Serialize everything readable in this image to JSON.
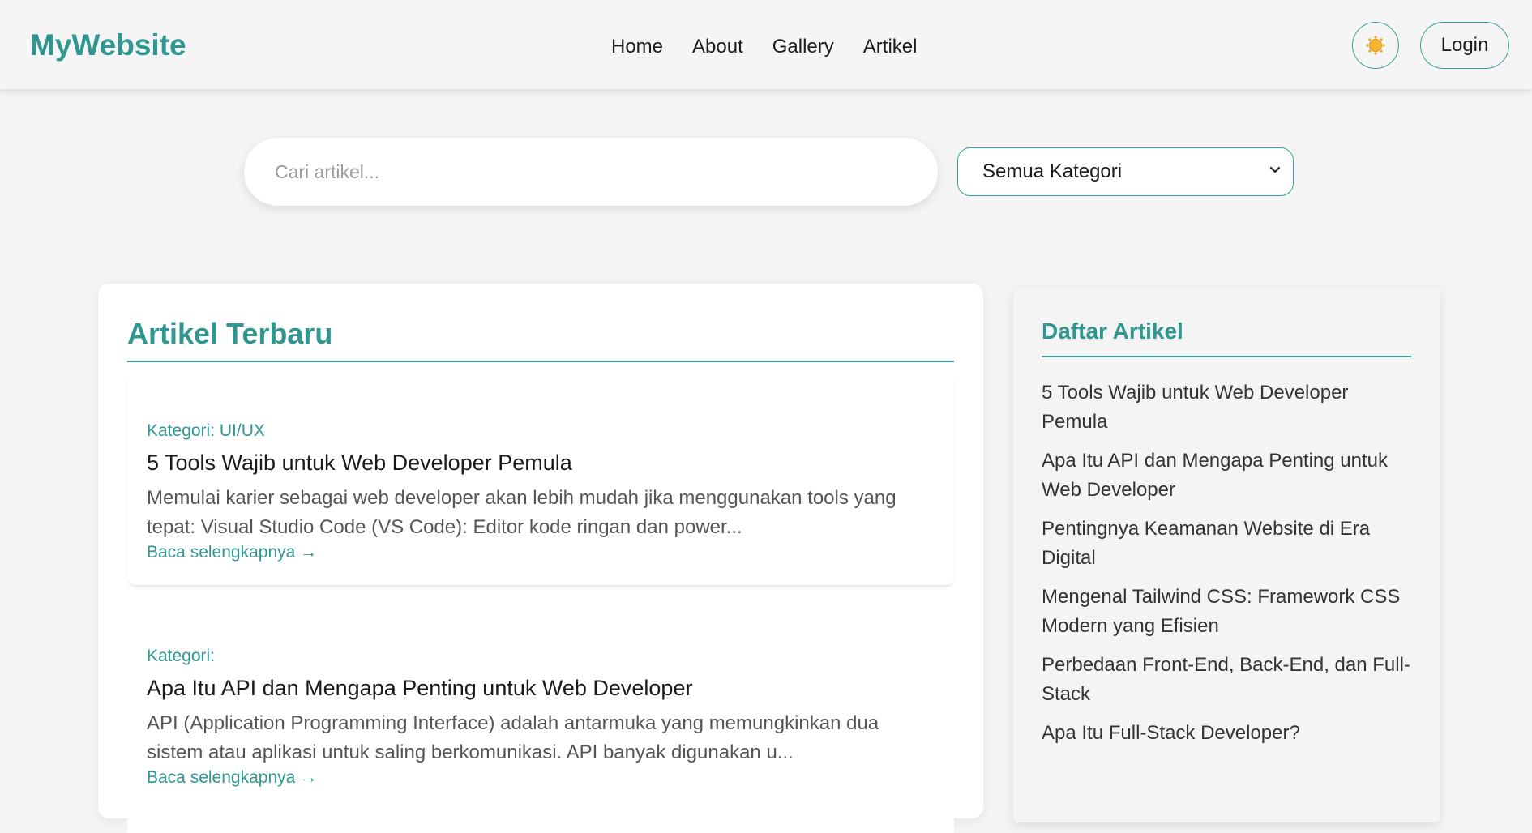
{
  "header": {
    "brand": "MyWebsite",
    "nav": [
      "Home",
      "About",
      "Gallery",
      "Artikel"
    ],
    "theme_icon": "sun-icon",
    "login_label": "Login"
  },
  "search": {
    "placeholder": "Cari artikel...",
    "category_selected": "Semua Kategori"
  },
  "main": {
    "title": "Artikel Terbaru",
    "articles": [
      {
        "category": "Kategori: UI/UX",
        "title": "5 Tools Wajib untuk Web Developer Pemula",
        "excerpt": "Memulai karier sebagai web developer akan lebih mudah jika menggunakan tools yang tepat: Visual Studio Code (VS Code): Editor kode ringan dan power...",
        "read_more": "Baca selengkapnya →"
      },
      {
        "category": "Kategori:",
        "title": "Apa Itu API dan Mengapa Penting untuk Web Developer",
        "excerpt": "API (Application Programming Interface) adalah antarmuka yang memungkinkan dua sistem atau aplikasi untuk saling berkomunikasi. API banyak digunakan u...",
        "read_more": "Baca selengkapnya →"
      }
    ]
  },
  "sidebar": {
    "title": "Daftar Artikel",
    "items": [
      "5 Tools Wajib untuk Web Developer Pemula",
      "Apa Itu API dan Mengapa Penting untuk Web Developer",
      "Pentingnya Keamanan Website di Era Digital",
      "Mengenal Tailwind CSS: Framework CSS Modern yang Efisien",
      "Perbedaan Front-End, Back-End, dan Full-Stack",
      "Apa Itu Full-Stack Developer?"
    ]
  },
  "colors": {
    "accent": "#2f9690",
    "border_accent": "#3aa39c",
    "page_bg": "#f4f4f4"
  }
}
